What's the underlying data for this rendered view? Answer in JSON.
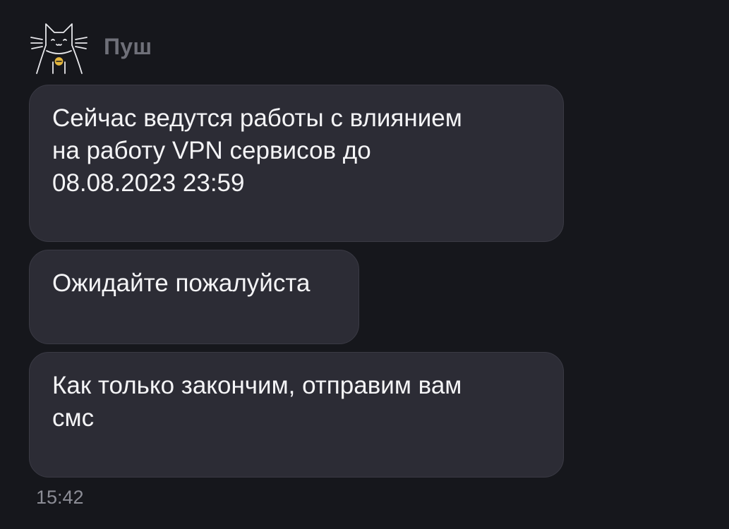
{
  "sender": {
    "name": "Пуш",
    "avatar_icon": "cat-icon"
  },
  "messages": [
    {
      "text": "Сейчас ведутся работы с влиянием\nна работу VPN сервисов до\n08.08.2023 23:59"
    },
    {
      "text": "Ожидайте пожалуйста"
    },
    {
      "text": "Как только закончим, отправим вам\nсмс"
    }
  ],
  "timestamp": "15:42",
  "colors": {
    "background": "#16171c",
    "bubble": "#2c2c35",
    "sender_name": "#6f7079",
    "bell": "#e3b53c"
  }
}
